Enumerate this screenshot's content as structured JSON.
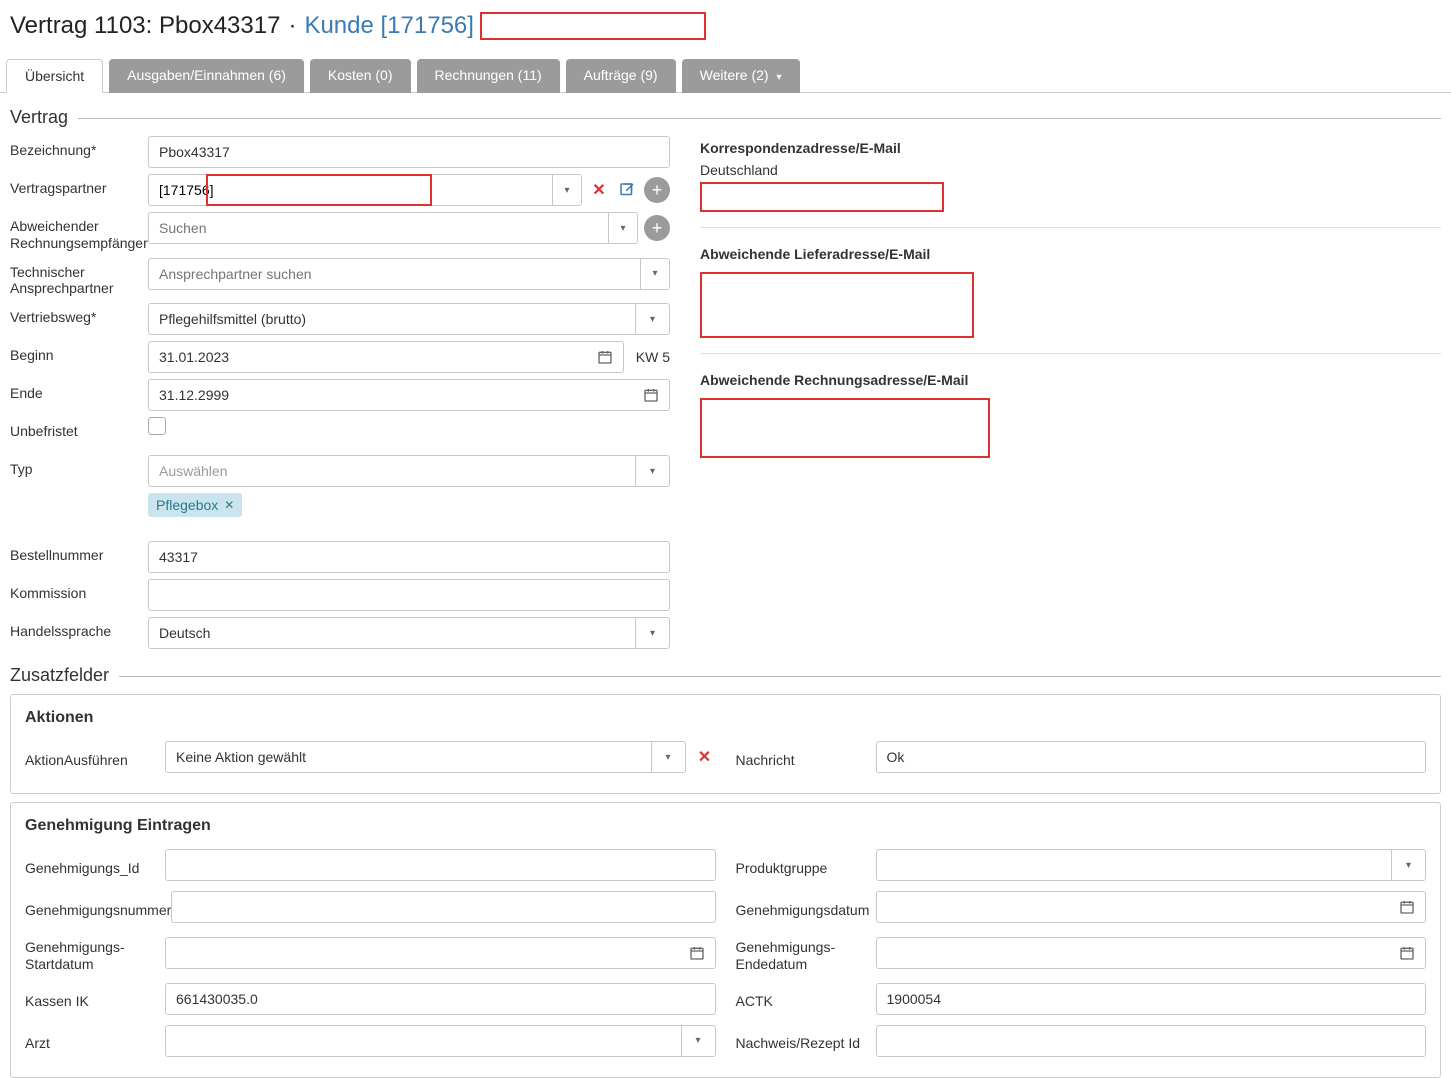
{
  "header": {
    "title_prefix": "Vertrag 1103: Pbox43317",
    "separator": "·",
    "customer_link": "Kunde [171756]"
  },
  "tabs": {
    "overview": "Übersicht",
    "expenses": "Ausgaben/Einnahmen (6)",
    "costs": "Kosten (0)",
    "invoices": "Rechnungen (11)",
    "orders": "Aufträge (9)",
    "more": "Weitere (2)"
  },
  "sections": {
    "contract": "Vertrag",
    "extra": "Zusatzfelder"
  },
  "labels": {
    "bezeichnung": "Bezeichnung*",
    "vertragspartner": "Vertragspartner",
    "abw_rechnung": "Abweichender Rechnungsempfänger",
    "tech_ansprech": "Technischer Ansprechpartner",
    "vertriebsweg": "Vertriebsweg*",
    "beginn": "Beginn",
    "ende": "Ende",
    "unbefristet": "Unbefristet",
    "typ": "Typ",
    "bestellnummer": "Bestellnummer",
    "kommission": "Kommission",
    "handelssprache": "Handelssprache",
    "korrespondenz": "Korrespondenzadresse/E-Mail",
    "abw_liefer": "Abweichende Lieferadresse/E-Mail",
    "abw_rech_addr": "Abweichende Rechnungsadresse/E-Mail"
  },
  "values": {
    "bezeichnung": "Pbox43317",
    "vertragspartner": "[171756]",
    "abw_rechnung_ph": "Suchen",
    "tech_ansprech_ph": "Ansprechpartner suchen",
    "vertriebsweg": "Pflegehilfsmittel (brutto)",
    "beginn": "31.01.2023",
    "kw": "KW 5",
    "ende": "31.12.2999",
    "typ_ph": "Auswählen",
    "tag": "Pflegebox",
    "bestellnummer": "43317",
    "kommission": "",
    "handelssprache": "Deutsch",
    "deutschland": "Deutschland"
  },
  "panels": {
    "aktionen": {
      "title": "Aktionen",
      "action_label": "AktionAusführen",
      "action_value": "Keine Aktion gewählt",
      "nachricht_label": "Nachricht",
      "nachricht_value": "Ok"
    },
    "genehmigung": {
      "title": "Genehmigung Eintragen",
      "id_label": "Genehmigungs_Id",
      "produktgruppe_label": "Produktgruppe",
      "nummer_label": "Genehmigungsnummer",
      "datum_label": "Genehmigungsdatum",
      "start_label": "Genehmigungs-Startdatum",
      "ende_label": "Genehmigungs-Endedatum",
      "kassen_label": "Kassen IK",
      "kassen_value": "661430035.0",
      "actk_label": "ACTK",
      "actk_value": "1900054",
      "arzt_label": "Arzt",
      "nachweis_label": "Nachweis/Rezept Id"
    }
  }
}
